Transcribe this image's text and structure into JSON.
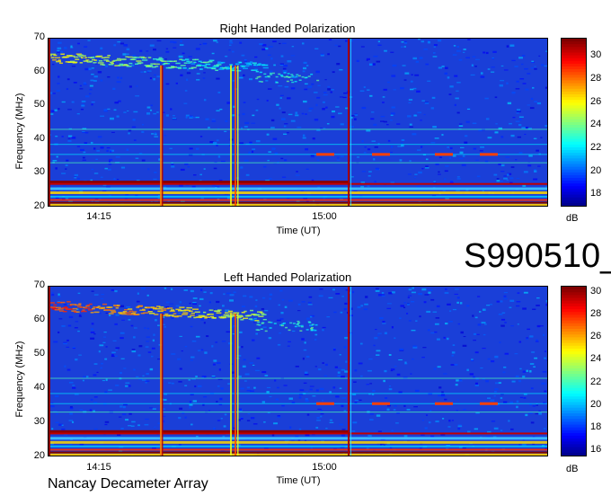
{
  "chart_data": [
    {
      "type": "heatmap",
      "title": "Right Handed Polarization",
      "xlabel": "Time (UT)",
      "ylabel": "Frequency (MHz)",
      "x_ticks": [
        "14:15",
        "15:00"
      ],
      "y_ticks": [
        20,
        30,
        40,
        50,
        60,
        70
      ],
      "ylim": [
        20,
        70
      ],
      "colorbar": {
        "label": "dB",
        "ticks": [
          18,
          20,
          22,
          24,
          26,
          28,
          30
        ],
        "range": [
          17,
          31.5
        ]
      }
    },
    {
      "type": "heatmap",
      "title": "Left Handed Polarization",
      "xlabel": "Time (UT)",
      "ylabel": "Frequency (MHz)",
      "x_ticks": [
        "14:15",
        "15:00"
      ],
      "y_ticks": [
        20,
        30,
        40,
        50,
        60,
        70
      ],
      "ylim": [
        20,
        70
      ],
      "colorbar": {
        "label": "dB",
        "ticks": [
          16,
          18,
          20,
          22,
          24,
          26,
          28,
          30
        ],
        "range": [
          15.5,
          30.5
        ]
      }
    }
  ],
  "observation_id": "S990510_",
  "instrument": "Nancay Decameter Array",
  "colormap": [
    "#00007f",
    "#0000ff",
    "#0080ff",
    "#00ffff",
    "#80ff80",
    "#ffff00",
    "#ff8000",
    "#ff0000",
    "#7f0000"
  ]
}
